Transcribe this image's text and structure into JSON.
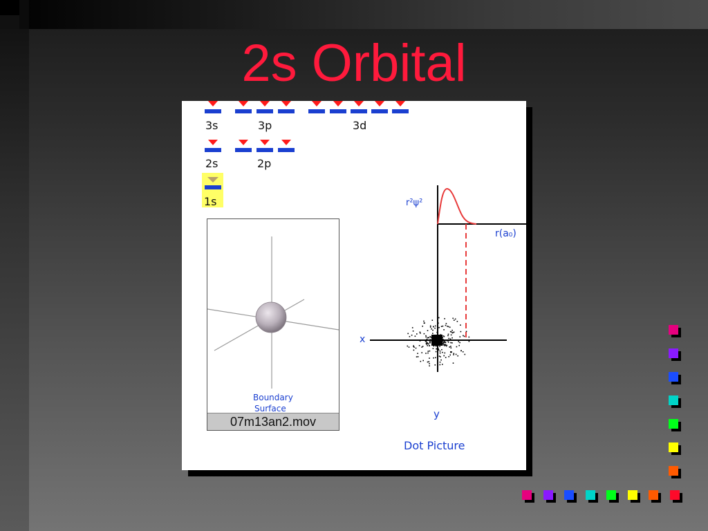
{
  "slide": {
    "title": "2s Orbital"
  },
  "figure": {
    "orbital_labels": {
      "s3": "3s",
      "p3": "3p",
      "d3": "3d",
      "s2": "2s",
      "p2": "2p",
      "s1": "1s"
    },
    "movie": {
      "caption": "07m13an2.mov",
      "boundary_label_1": "Boundary",
      "boundary_label_2": "Surface"
    },
    "graph": {
      "ylabel": "r²ψ²",
      "xlabel": "r(a₀)",
      "x_axis_label": "x",
      "y_axis_label": "y",
      "caption": "Dot Picture"
    }
  },
  "colors": {
    "title": "#ff1a3c",
    "accent_blue": "#1a3fd0",
    "arrow_red": "#ff1a1a",
    "highlight_yellow": "#ffff66"
  },
  "bullets": [
    {
      "color": "#e6007e"
    },
    {
      "color": "#8a1aff"
    },
    {
      "color": "#1a4dff"
    },
    {
      "color": "#00d4c8"
    },
    {
      "color": "#00ff1a"
    },
    {
      "color": "#ffff00"
    },
    {
      "color": "#ff5a00"
    },
    {
      "color": "#ff0a2a"
    }
  ]
}
